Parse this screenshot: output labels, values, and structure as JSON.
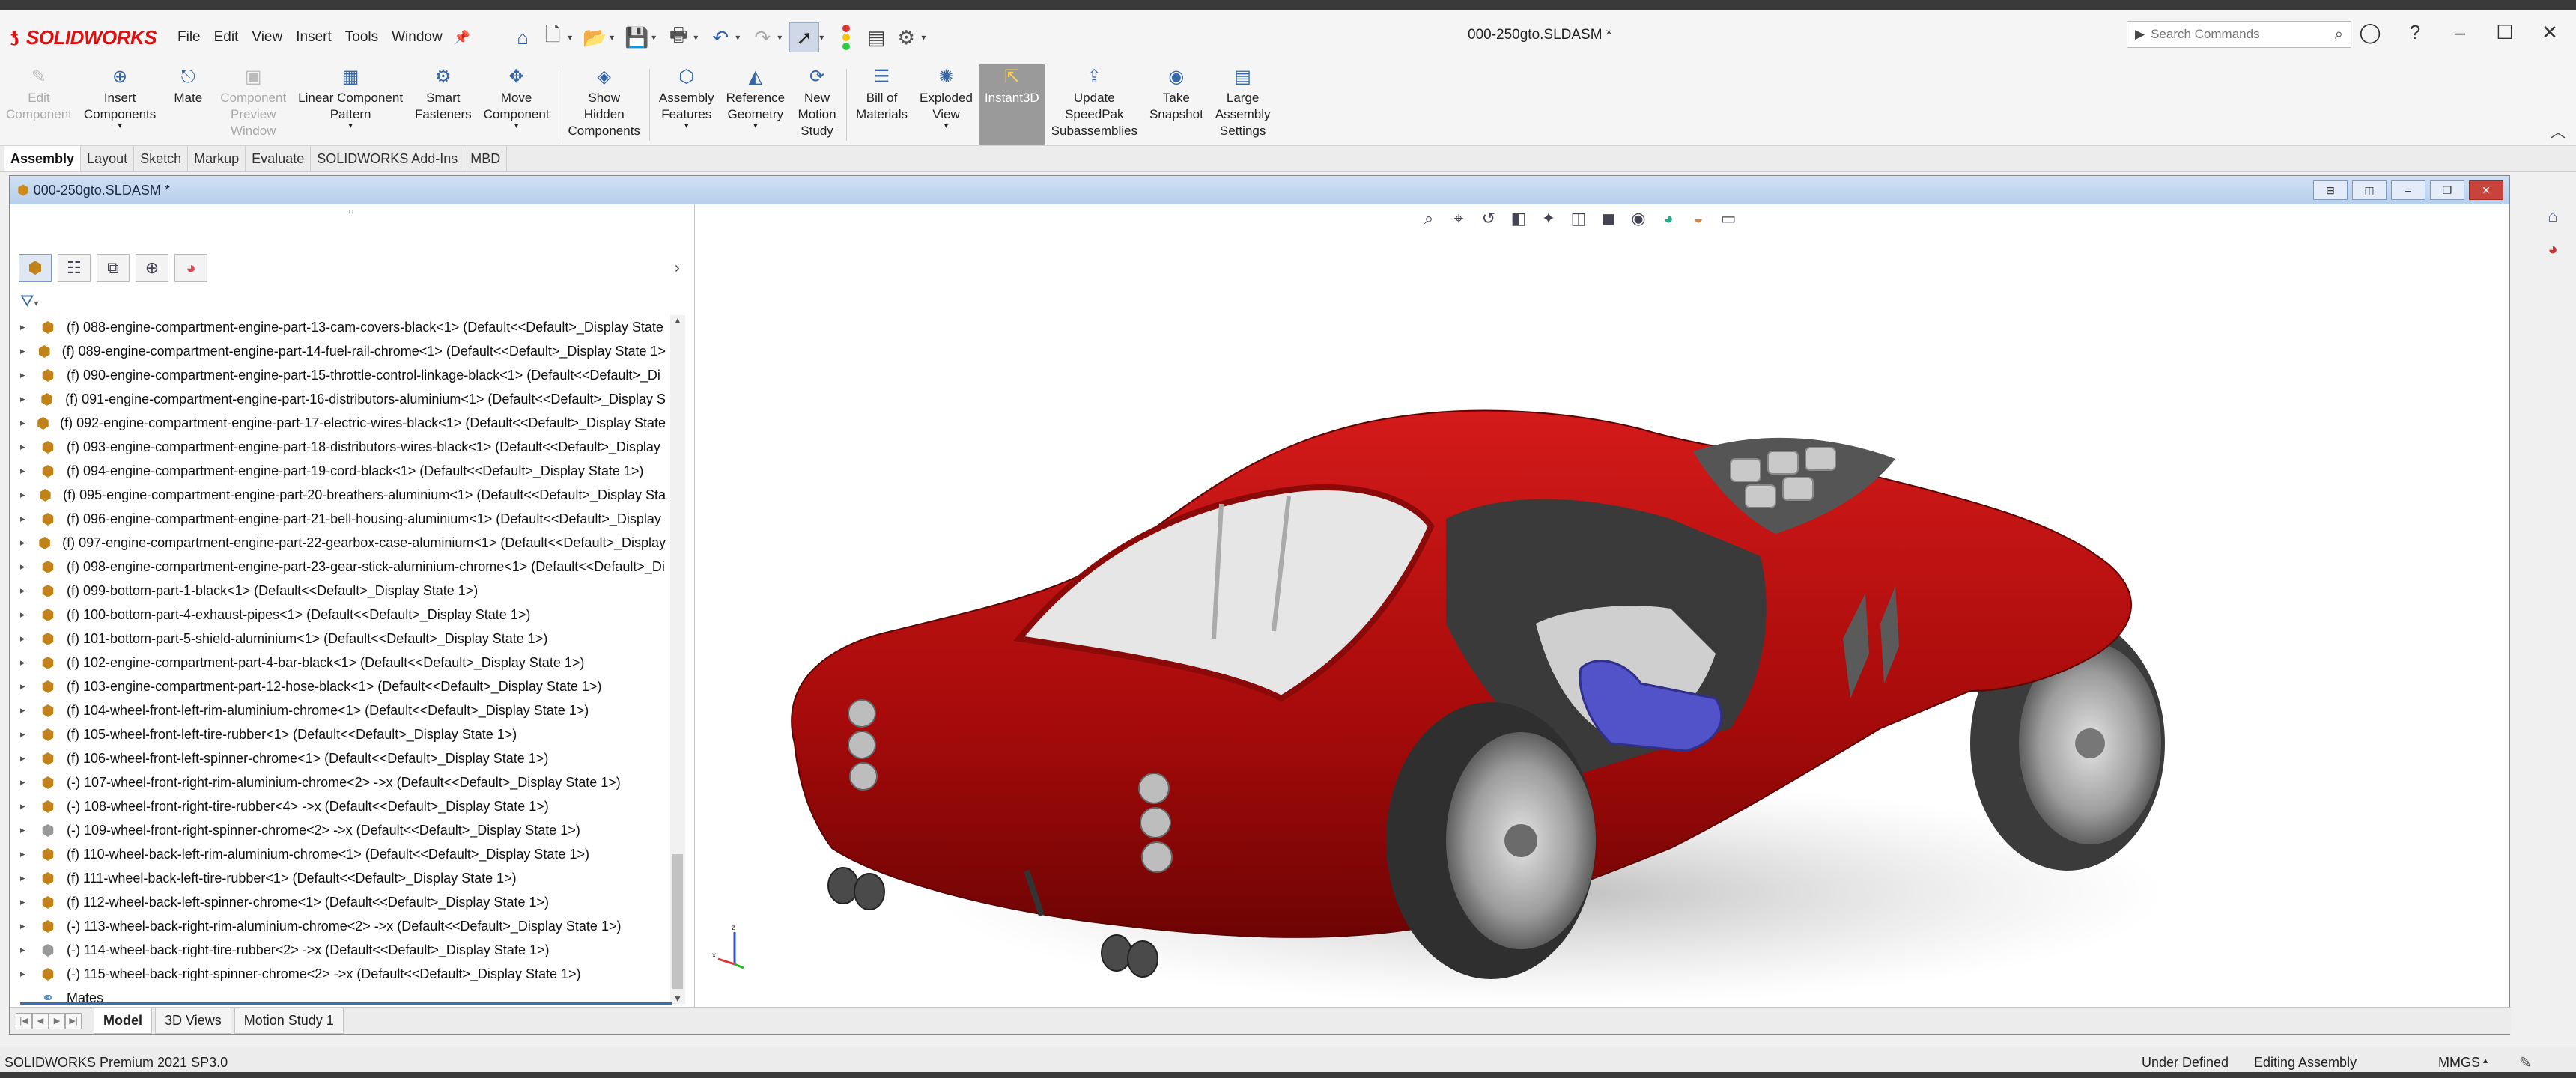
{
  "app": {
    "logo_text": "SOLIDWORKS",
    "document_title": "000-250gto.SLDASM *",
    "menus": [
      "File",
      "Edit",
      "View",
      "Insert",
      "Tools",
      "Window"
    ],
    "search_placeholder": "Search Commands"
  },
  "ribbon": [
    {
      "label": "Edit\nComponent",
      "icon": "edit-component-icon",
      "glyph": "✎",
      "disabled": true
    },
    {
      "label": "Insert\nComponents",
      "icon": "insert-components-icon",
      "glyph": "⊕",
      "disabled": false,
      "dropdown": true
    },
    {
      "label": "Mate",
      "icon": "mate-icon",
      "glyph": "⎋",
      "disabled": false
    },
    {
      "label": "Component\nPreview\nWindow",
      "icon": "component-preview-icon",
      "glyph": "▣",
      "disabled": true
    },
    {
      "label": "Linear Component\nPattern",
      "icon": "linear-pattern-icon",
      "glyph": "▦",
      "disabled": false,
      "dropdown": true
    },
    {
      "label": "Smart\nFasteners",
      "icon": "smart-fasteners-icon",
      "glyph": "⚙",
      "disabled": false
    },
    {
      "label": "Move\nComponent",
      "icon": "move-component-icon",
      "glyph": "✥",
      "disabled": false,
      "dropdown": true
    },
    {
      "sep": true
    },
    {
      "label": "Show\nHidden\nComponents",
      "icon": "show-hidden-icon",
      "glyph": "◈",
      "disabled": false
    },
    {
      "sep": true
    },
    {
      "label": "Assembly\nFeatures",
      "icon": "assembly-features-icon",
      "glyph": "⬡",
      "disabled": false,
      "dropdown": true
    },
    {
      "label": "Reference\nGeometry",
      "icon": "reference-geometry-icon",
      "glyph": "◭",
      "disabled": false,
      "dropdown": true
    },
    {
      "label": "New\nMotion\nStudy",
      "icon": "motion-study-icon",
      "glyph": "⟳",
      "disabled": false
    },
    {
      "sep": true
    },
    {
      "label": "Bill of\nMaterials",
      "icon": "bom-icon",
      "glyph": "☰",
      "disabled": false
    },
    {
      "label": "Exploded\nView",
      "icon": "exploded-view-icon",
      "glyph": "✺",
      "disabled": false,
      "dropdown": true
    },
    {
      "label": "Instant3D",
      "icon": "instant3d-icon",
      "glyph": "⇱",
      "disabled": false,
      "active": true
    },
    {
      "label": "Update\nSpeedPak\nSubassemblies",
      "icon": "speedpak-icon",
      "glyph": "⇪",
      "disabled": false
    },
    {
      "label": "Take\nSnapshot",
      "icon": "snapshot-icon",
      "glyph": "◉",
      "disabled": false
    },
    {
      "label": "Large\nAssembly\nSettings",
      "icon": "large-assembly-icon",
      "glyph": "▤",
      "disabled": false
    }
  ],
  "command_tabs": [
    "Assembly",
    "Layout",
    "Sketch",
    "Markup",
    "Evaluate",
    "SOLIDWORKS Add-Ins",
    "MBD"
  ],
  "active_command_tab": "Assembly",
  "tree": [
    {
      "text": "(f) 088-engine-compartment-engine-part-13-cam-covers-black<1> (Default<<Default>_Display State",
      "dim": false
    },
    {
      "text": "(f) 089-engine-compartment-engine-part-14-fuel-rail-chrome<1> (Default<<Default>_Display State 1>",
      "dim": false
    },
    {
      "text": "(f) 090-engine-compartment-engine-part-15-throttle-control-linkage-black<1> (Default<<Default>_Di",
      "dim": false
    },
    {
      "text": "(f) 091-engine-compartment-engine-part-16-distributors-aluminium<1> (Default<<Default>_Display S",
      "dim": false
    },
    {
      "text": "(f) 092-engine-compartment-engine-part-17-electric-wires-black<1> (Default<<Default>_Display State",
      "dim": false
    },
    {
      "text": "(f) 093-engine-compartment-engine-part-18-distributors-wires-black<1> (Default<<Default>_Display",
      "dim": false
    },
    {
      "text": "(f) 094-engine-compartment-engine-part-19-cord-black<1> (Default<<Default>_Display State 1>)",
      "dim": false
    },
    {
      "text": "(f) 095-engine-compartment-engine-part-20-breathers-aluminium<1> (Default<<Default>_Display Sta",
      "dim": false
    },
    {
      "text": "(f) 096-engine-compartment-engine-part-21-bell-housing-aluminium<1> (Default<<Default>_Display",
      "dim": false
    },
    {
      "text": "(f) 097-engine-compartment-engine-part-22-gearbox-case-aluminium<1> (Default<<Default>_Display",
      "dim": false
    },
    {
      "text": "(f) 098-engine-compartment-engine-part-23-gear-stick-aluminium-chrome<1> (Default<<Default>_Di",
      "dim": false
    },
    {
      "text": "(f) 099-bottom-part-1-black<1> (Default<<Default>_Display State 1>)",
      "dim": false
    },
    {
      "text": "(f) 100-bottom-part-4-exhaust-pipes<1> (Default<<Default>_Display State 1>)",
      "dim": false
    },
    {
      "text": "(f) 101-bottom-part-5-shield-aluminium<1> (Default<<Default>_Display State 1>)",
      "dim": false
    },
    {
      "text": "(f) 102-engine-compartment-part-4-bar-black<1> (Default<<Default>_Display State 1>)",
      "dim": false
    },
    {
      "text": "(f) 103-engine-compartment-part-12-hose-black<1> (Default<<Default>_Display State 1>)",
      "dim": false
    },
    {
      "text": "(f) 104-wheel-front-left-rim-aluminium-chrome<1> (Default<<Default>_Display State 1>)",
      "dim": false
    },
    {
      "text": "(f) 105-wheel-front-left-tire-rubber<1> (Default<<Default>_Display State 1>)",
      "dim": false
    },
    {
      "text": "(f) 106-wheel-front-left-spinner-chrome<1> (Default<<Default>_Display State 1>)",
      "dim": false
    },
    {
      "text": "(-) 107-wheel-front-right-rim-aluminium-chrome<2> ->x (Default<<Default>_Display State 1>)",
      "dim": false
    },
    {
      "text": "(-) 108-wheel-front-right-tire-rubber<4> ->x (Default<<Default>_Display State 1>)",
      "dim": false
    },
    {
      "text": "(-) 109-wheel-front-right-spinner-chrome<2> ->x (Default<<Default>_Display State 1>)",
      "dim": true
    },
    {
      "text": "(f) 110-wheel-back-left-rim-aluminium-chrome<1> (Default<<Default>_Display State 1>)",
      "dim": false
    },
    {
      "text": "(f) 111-wheel-back-left-tire-rubber<1> (Default<<Default>_Display State 1>)",
      "dim": false
    },
    {
      "text": "(f) 112-wheel-back-left-spinner-chrome<1> (Default<<Default>_Display State 1>)",
      "dim": false
    },
    {
      "text": "(-) 113-wheel-back-right-rim-aluminium-chrome<2> ->x (Default<<Default>_Display State 1>)",
      "dim": false
    },
    {
      "text": "(-) 114-wheel-back-right-tire-rubber<2> ->x (Default<<Default>_Display State 1>)",
      "dim": true
    },
    {
      "text": "(-) 115-wheel-back-right-spinner-chrome<2> ->x (Default<<Default>_Display State 1>)",
      "dim": false
    },
    {
      "text": "Mates",
      "dim": false,
      "mates": true
    }
  ],
  "bottom_tabs": [
    "Model",
    "3D Views",
    "Motion Study 1"
  ],
  "active_bottom_tab": "Model",
  "status": {
    "product": "SOLIDWORKS Premium 2021 SP3.0",
    "definition": "Under Defined",
    "mode": "Editing Assembly",
    "units": "MMGS"
  },
  "triad_axis_z": "z",
  "triad_axis_x": "x",
  "colors": {
    "car_body": "#b40d0d",
    "brand_red": "#d11111",
    "active_tab_bg": "#9a9a9a",
    "seat_blue": "#5252c9"
  }
}
